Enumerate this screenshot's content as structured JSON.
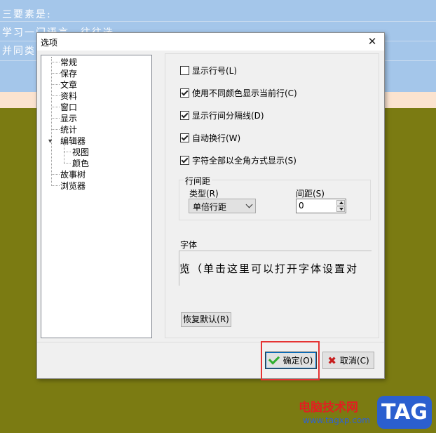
{
  "background": {
    "lines": [
      "三要素是:",
      "学习一门语言，往往选",
      "并同类"
    ]
  },
  "dialog": {
    "title": "选项",
    "close_glyph": "✕",
    "tree": {
      "items": [
        "常规",
        "保存",
        "文章",
        "资料",
        "窗口",
        "显示",
        "统计",
        "编辑器",
        "视图",
        "颜色",
        "故事树",
        "浏览器"
      ]
    },
    "checkboxes": [
      {
        "label": "显示行号(L)",
        "checked": false
      },
      {
        "label": "使用不同颜色显示当前行(C)",
        "checked": true
      },
      {
        "label": "显示行间分隔线(D)",
        "checked": true
      },
      {
        "label": "自动换行(W)",
        "checked": true
      },
      {
        "label": "字符全部以全角方式显示(S)",
        "checked": true
      }
    ],
    "spacing": {
      "group_label": "行间距",
      "type_label": "类型(R)",
      "type_value": "单倍行距",
      "gap_label": "间距(S)",
      "gap_value": "0"
    },
    "font": {
      "label": "字体",
      "preview": "览（单击这里可以打开字体设置对"
    },
    "reset_label": "恢复默认(R)",
    "ok_label": "确定(O)",
    "cancel_label": "取消(C)"
  },
  "watermark": {
    "site": "电脑技术网",
    "url": "www.tagxp.com",
    "tag": "TAG"
  },
  "colors": {
    "editor_bg": "#a4c6ea",
    "current_line": "#fbe3cf",
    "desktop": "#7b7b12",
    "highlight": "#e53333"
  }
}
